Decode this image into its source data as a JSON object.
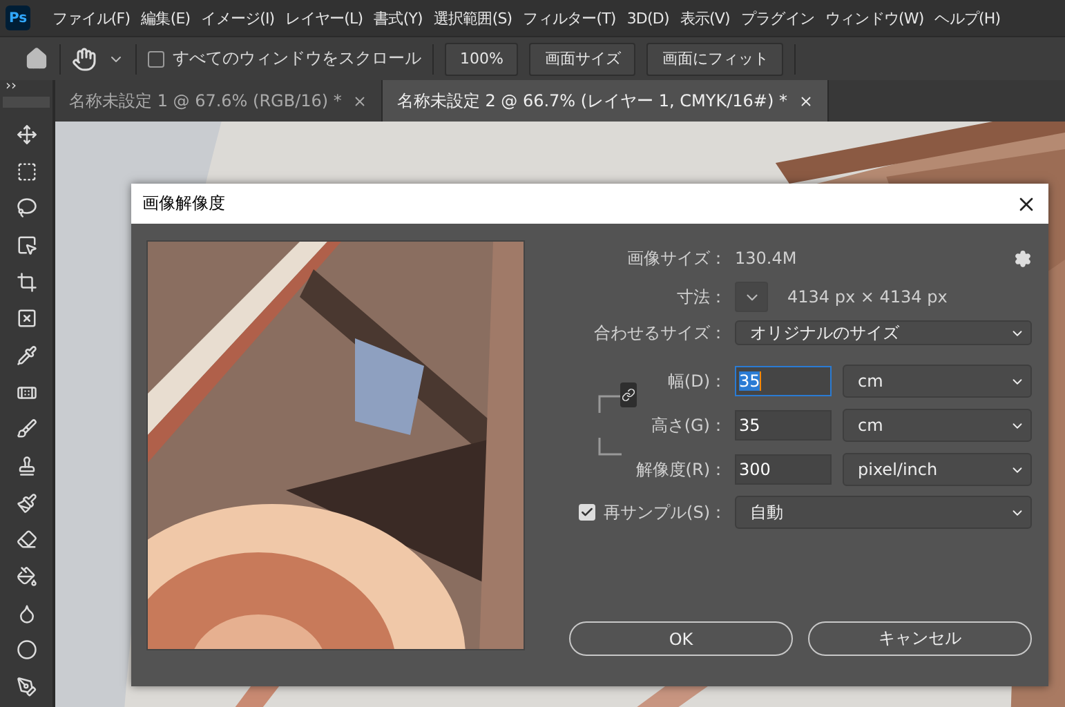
{
  "menu_bar": {
    "logo": "Ps",
    "items": [
      "ファイル(F)",
      "編集(E)",
      "イメージ(I)",
      "レイヤー(L)",
      "書式(Y)",
      "選択範囲(S)",
      "フィルター(T)",
      "3D(D)",
      "表示(V)",
      "プラグイン",
      "ウィンドウ(W)",
      "ヘルプ(H)"
    ]
  },
  "options_bar": {
    "scroll_all": {
      "label": "すべてのウィンドウをスクロール",
      "checked": false
    },
    "buttons": [
      "100%",
      "画面サイズ",
      "画面にフィット"
    ]
  },
  "panel_toggle": "››",
  "tabs": [
    {
      "label": "名称未設定 1 @ 67.6% (RGB/16) *",
      "selected": false
    },
    {
      "label": "名称未設定 2 @ 66.7% (レイヤー 1, CMYK/16#) *",
      "selected": true
    }
  ],
  "dialog": {
    "title": "画像解像度",
    "image_size": {
      "label": "画像サイズ：",
      "value": "130.4M"
    },
    "dimensions": {
      "label": "寸法：",
      "value": "4134 px × 4134 px"
    },
    "fit_to": {
      "label": "合わせるサイズ：",
      "value": "オリジナルのサイズ"
    },
    "fields": [
      {
        "label": "幅(D)：",
        "value": "35",
        "unit": "cm",
        "focused": true
      },
      {
        "label": "高さ(G)：",
        "value": "35",
        "unit": "cm",
        "focused": false
      },
      {
        "label": "解像度(R)：",
        "value": "300",
        "unit": "pixel/inch",
        "focused": false
      }
    ],
    "constrain": {
      "on": true
    },
    "resample": {
      "label": "再サンプル(S)：",
      "checked": true,
      "value": "自動"
    },
    "buttons": [
      "OK",
      "キャンセル"
    ]
  }
}
